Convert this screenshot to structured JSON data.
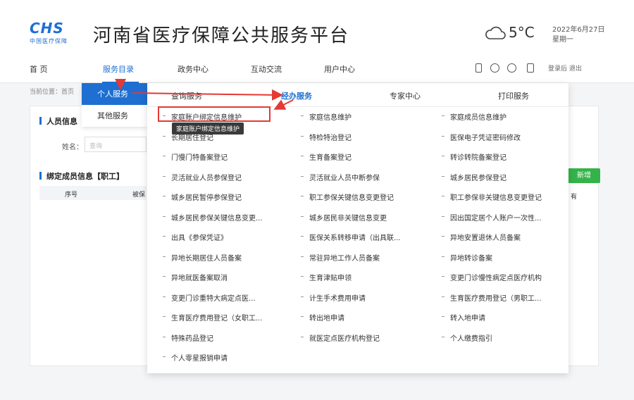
{
  "logo": {
    "mark": "CHS",
    "subtitle": "中国医疗保障"
  },
  "header": {
    "title": "河南省医疗保障公共服务平台",
    "temperature": "5°C",
    "date": "2022年6月27日",
    "weekday": "星期一"
  },
  "nav": {
    "items": [
      "首  页",
      "服务目录",
      "政务中心",
      "互动交流",
      "用户中心"
    ],
    "links": "登录后  退出"
  },
  "page": {
    "breadcrumb": "当前位置：首页",
    "section1": "人员信息",
    "name_label": "姓名：",
    "name_placeholder": "查询",
    "section2": "绑定成员信息【职工】",
    "table_cols": [
      "序号",
      "被保"
    ],
    "add_button": "新增",
    "right_fragment": "有"
  },
  "level1": [
    "个人服务",
    "其他服务"
  ],
  "mega": {
    "tabs": [
      "查询服务",
      "经办服务",
      "专家中心",
      "打印服务"
    ],
    "columns": [
      [
        "家庭账户绑定信息维护",
        "长期居住登记",
        "门慢门特备案登记",
        "灵活就业人员参保登记",
        "城乡居民暂停参保登记",
        "城乡居民参保关键信息变更...",
        "出具《参保凭证》",
        "异地长期居住人员备案",
        "异地就医备案取消",
        "变更门诊重特大病定点医...",
        "生育医疗费用登记（女职工...",
        "特殊药品登记",
        "个人零星报销申请"
      ],
      [
        "家庭信息维护",
        "特检特治登记",
        "生育备案登记",
        "灵活就业人员中断参保",
        "职工参保关键信息变更登记",
        "城乡居民非关键信息变更",
        "医保关系转移申请（出具联...",
        "常驻异地工作人员备案",
        "生育津贴申领",
        "计生手术费用申请",
        "转出地申请",
        "就医定点医疗机构登记"
      ],
      [
        "家庭成员信息维护",
        "医保电子凭证密码修改",
        "转诊转院备案登记",
        "城乡居民参保登记",
        "职工参保非关键信息变更登记",
        "因出国定居个人账户一次性...",
        "异地安置退休人员备案",
        "异地转诊备案",
        "变更门诊慢性病定点医疗机构",
        "生育医疗费用登记（男职工...",
        "转入地申请",
        "个人缴费指引"
      ]
    ],
    "tooltip": "家庭账户绑定信息维护"
  },
  "colors": {
    "accent": "#1e6fd1",
    "highlight": "#e53935",
    "add_button": "#34b34a"
  }
}
